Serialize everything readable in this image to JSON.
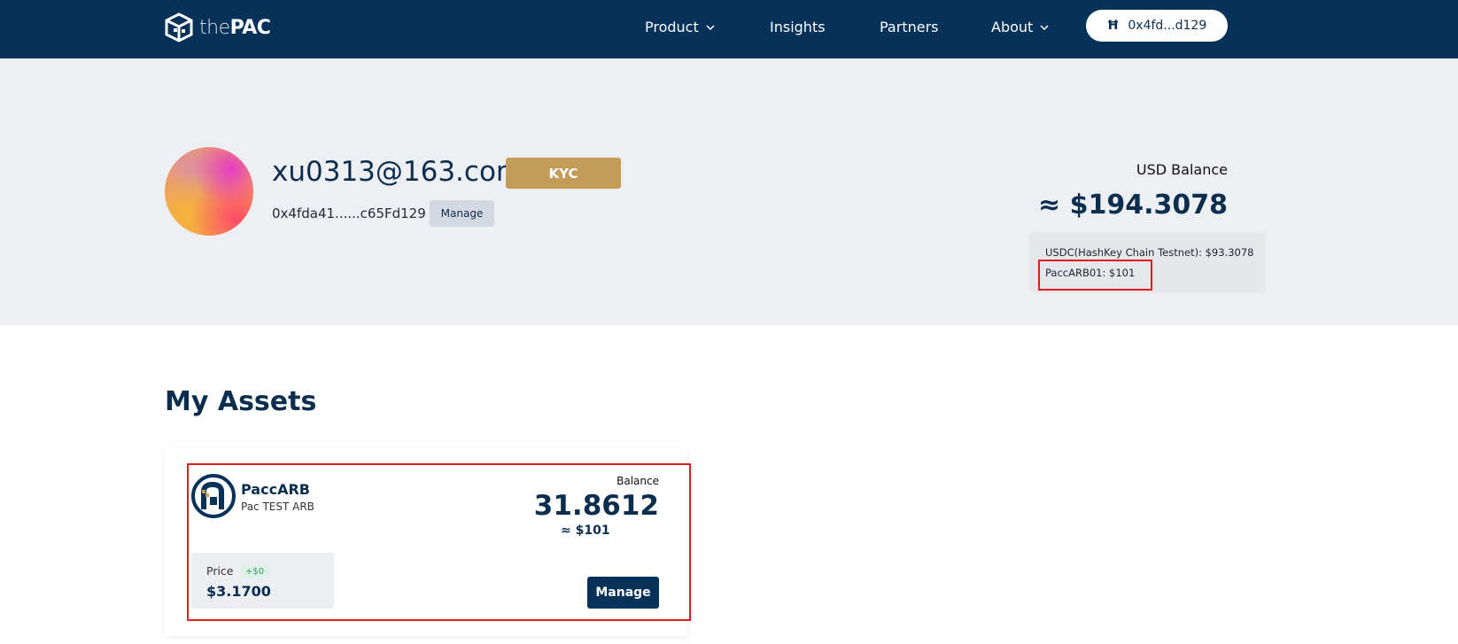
{
  "header": {
    "logo": {
      "prefix": "the",
      "brand": "PAC"
    },
    "nav": [
      {
        "label": "Product",
        "has_dropdown": true
      },
      {
        "label": "Insights",
        "has_dropdown": false
      },
      {
        "label": "Partners",
        "has_dropdown": false
      },
      {
        "label": "About",
        "has_dropdown": true
      }
    ],
    "wallet": {
      "icon": "hashkey-icon",
      "address": "0x4fd...d129"
    }
  },
  "profile": {
    "email": "xu0313@163.com",
    "kyc_label": "KYC",
    "address": "0x4fda41......c65Fd129",
    "manage_label": "Manage"
  },
  "balance": {
    "label": "USD Balance",
    "value": "≈ $194.3078",
    "breakdown": [
      "USDC(HashKey Chain Testnet): $93.3078",
      "PaccARB01: $101"
    ],
    "highlight_color": "#e01b24"
  },
  "assets": {
    "title": "My Assets",
    "items": [
      {
        "symbol": "PaccARB",
        "name": "Pac TEST ARB",
        "balance_label": "Balance",
        "balance": "31.8612",
        "balance_usd": "≈ $101",
        "price_label": "Price",
        "price_change": "+$0",
        "price": "$3.1700",
        "manage_label": "Manage"
      }
    ]
  },
  "colors": {
    "navy": "#06325a",
    "kyc_gold": "#c39c57",
    "hero_bg": "#eeeff3"
  }
}
